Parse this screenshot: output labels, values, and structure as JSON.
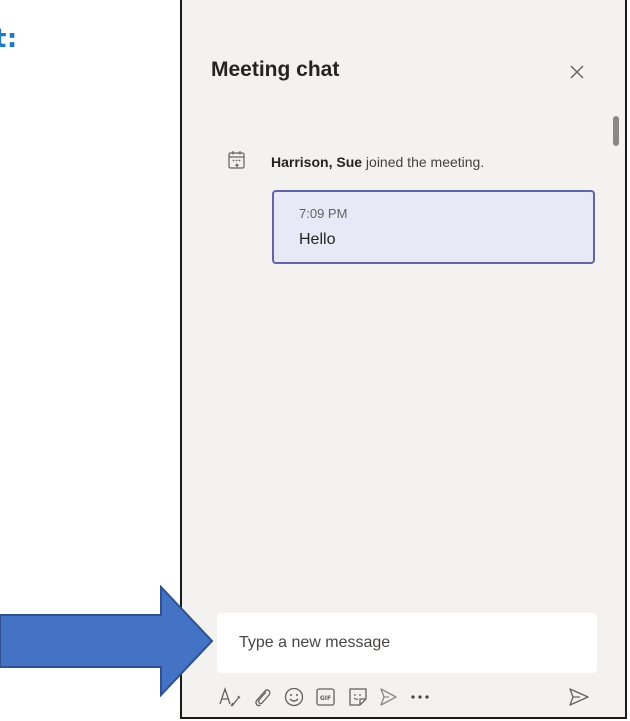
{
  "fragment_title": "t:",
  "chat": {
    "title": "Meeting chat",
    "event": {
      "name": "Harrison, Sue",
      "text": " joined the meeting."
    },
    "messages": [
      {
        "time": "7:09 PM",
        "text": "Hello"
      }
    ],
    "compose": {
      "placeholder": "Type a new message"
    }
  },
  "toolbar": {
    "icons": [
      "format-icon",
      "attach-icon",
      "emoji-icon",
      "gif-icon",
      "sticker-icon",
      "schedule-send-icon",
      "more-options-icon",
      "send-icon"
    ]
  },
  "colors": {
    "title_blue": "#1f7ac4",
    "panel_bg": "#f3f2f1",
    "bubble_bg": "#e8e8f6",
    "bubble_border": "#6264a7",
    "pointer_arrow": "#4472c4"
  }
}
